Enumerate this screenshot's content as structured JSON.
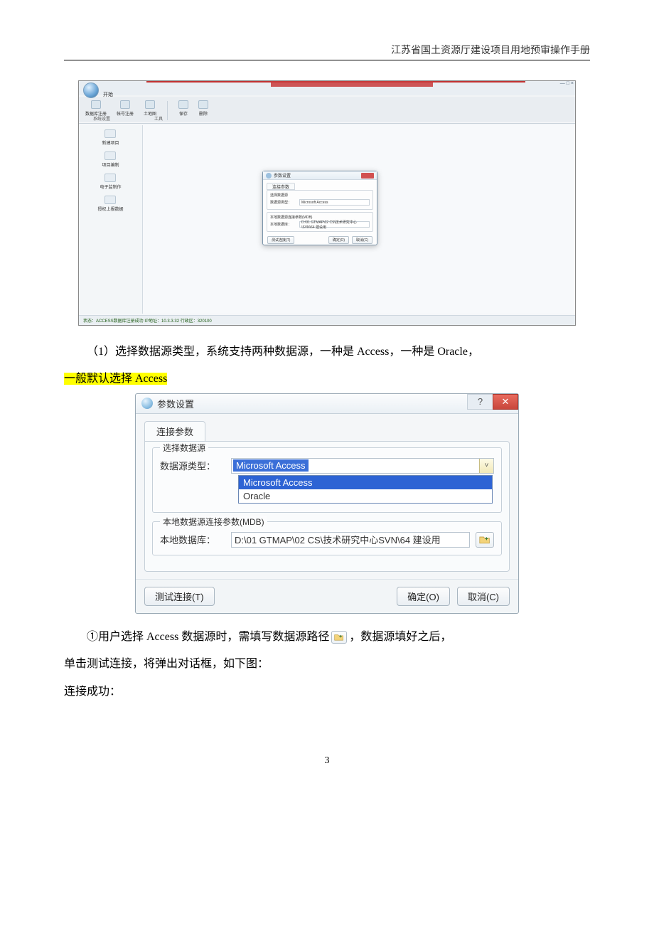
{
  "header": "江苏省国土资源厅建设项目用地预审操作手册",
  "page_number": "3",
  "text": {
    "p1_a": "（1）选择数据源类型，系统支持两种数据源，一种是 Access，一种是 Oracle，",
    "p1_b_hl": "一般默认选择 Access",
    "p2_a": "①用户选择 Access 数据源时，需填写数据源路径",
    "p2_b": "，数据源填好之后，",
    "p3": "单击测试连接，将弹出对话框，如下图：",
    "p4": "连接成功："
  },
  "fig1": {
    "win_controls": "—  □  ×",
    "menu_start": "开始",
    "ribbon": {
      "items": [
        "数据库注册",
        "帐号注册",
        "土地图",
        "保存",
        "删除"
      ],
      "group1": "系统设置",
      "group2": "工具"
    },
    "side": [
      "新建项目",
      "项目编制",
      "电子监制作",
      "授权上报数据"
    ],
    "status": "状态：ACCESS数据库注册成功   IP地址：10.3.3.32   行政区：320100",
    "dialog": {
      "title": "参数设置",
      "tab": "连接参数",
      "grp1": "选择数据源",
      "type_label": "数据源类型：",
      "type_value": "Microsoft Access",
      "grp2": "本地数据源连接参数(MDB)",
      "db_label": "本地数据库：",
      "db_value": "D:\\01 GTMAP\\02 CS\\技术研究中心\\SVN\\64 建设用",
      "test": "测试连接(T)",
      "ok": "确定(O)",
      "cancel": "取消(C)"
    }
  },
  "fig2": {
    "title": "参数设置",
    "tab": "连接参数",
    "grp1": "选择数据源",
    "type_label": "数据源类型：",
    "type_selected": "Microsoft Access",
    "options": {
      "opt1": "Microsoft Access",
      "opt2": "Oracle"
    },
    "grp2": "本地数据源连接参数(MDB)",
    "db_label": "本地数据库：",
    "db_value": "D:\\01 GTMAP\\02 CS\\技术研究中心SVN\\64 建设用",
    "test": "测试连接(T)",
    "ok": "确定(O)",
    "cancel": "取消(C)"
  }
}
